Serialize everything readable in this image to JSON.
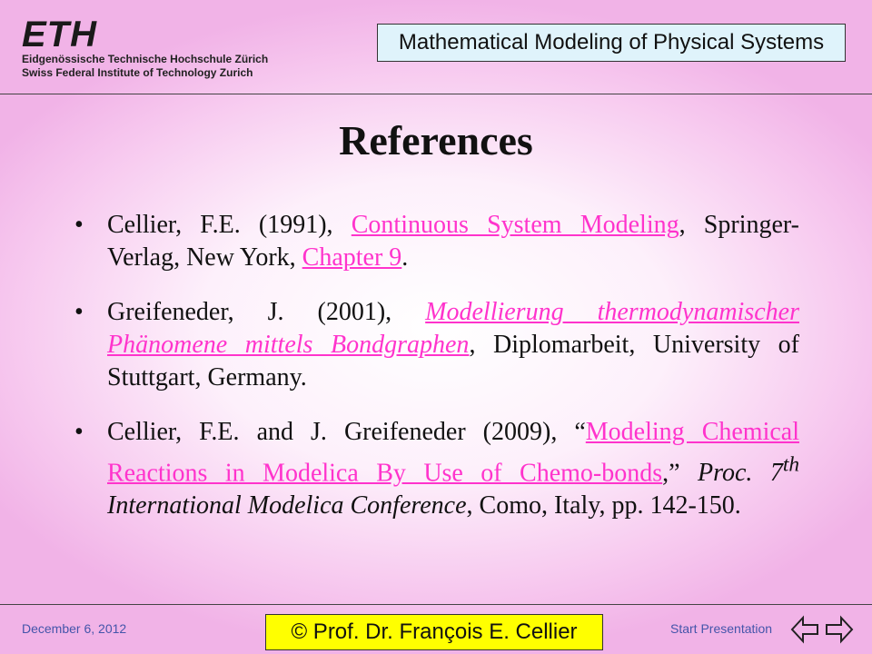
{
  "header": {
    "logo": {
      "mark": "ETH",
      "line1": "Eidgenössische Technische Hochschule Zürich",
      "line2": "Swiss Federal Institute of Technology Zurich"
    },
    "course_title": "Mathematical Modeling of Physical Systems"
  },
  "title": "References",
  "references": [
    {
      "bullet": "•",
      "pre": "Cellier, F.E. (1991), ",
      "link1": "Continuous System Modeling",
      "mid": ", Springer-Verlag, New York, ",
      "link2": "Chapter 9",
      "post": "."
    },
    {
      "bullet": "•",
      "pre": "Greifeneder, J. (2001), ",
      "link1": "Modellierung thermodynamischer Phänomene mittels Bondgraphen",
      "post": ", Diplomarbeit, University of Stuttgart, Germany."
    },
    {
      "bullet": "•",
      "pre": "Cellier, F.E. and J. Greifeneder (2009), “",
      "link1": "Modeling Chemical Reactions in Modelica By Use of Chemo-bonds",
      "mid": ",” ",
      "proc": "Proc. 7",
      "sup": "th",
      "conf": " International Modelica Conference",
      "post": ", Como, Italy, pp. 142-150."
    }
  ],
  "footer": {
    "date": "December 6, 2012",
    "copyright": "© Prof. Dr. François E. Cellier",
    "start": "Start Presentation"
  },
  "icons": {
    "back": "back-arrow-icon",
    "forward": "forward-arrow-icon"
  },
  "colors": {
    "link": "#ff33cc",
    "course_box": "#dff3fb",
    "copyright_box": "#ffff00"
  }
}
